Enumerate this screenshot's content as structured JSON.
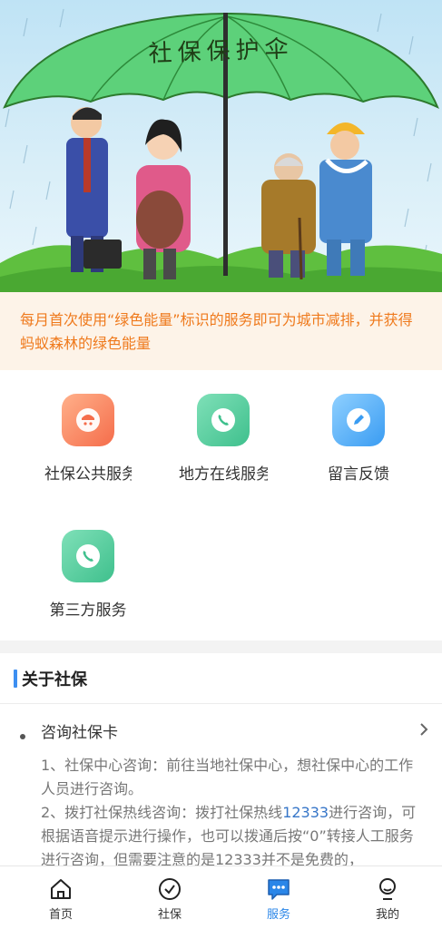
{
  "banner": {
    "umbrella_title": "社保保护伞"
  },
  "notice": {
    "text": "每月首次使用“绿色能量”标识的服务即可为城市减排，并获得蚂蚁森林的绿色能量"
  },
  "services": [
    {
      "label": "社保公共服务",
      "icon": "social-security-icon",
      "color": "#f56d4b"
    },
    {
      "label": "地方在线服务",
      "icon": "phone-icon",
      "color": "#3fc08d"
    },
    {
      "label": "留言反馈",
      "icon": "pen-icon",
      "color": "#3a9cf2"
    },
    {
      "label": "第三方服务",
      "icon": "phone-icon",
      "color": "#3fc08d"
    }
  ],
  "about": {
    "title": "关于社保",
    "faq": {
      "question": "咨询社保卡",
      "line1": "1、社保中心咨询：前往当地社保中心，想社保中心的工作人员进行咨询。",
      "line2_pre": "2、拨打社保热线咨询：拨打社保热线",
      "hotline": "12333",
      "line2_post": "进行咨询，可根据语音提示进行操作，也可以拨通后按“0”转接人工服务进行咨询，但需要注意的是12333并不是免费的，"
    }
  },
  "tabbar": {
    "tabs": [
      {
        "label": "首页",
        "icon": "home-icon"
      },
      {
        "label": "社保",
        "icon": "check-circle-icon"
      },
      {
        "label": "服务",
        "icon": "chat-icon",
        "active": true
      },
      {
        "label": "我的",
        "icon": "user-icon"
      }
    ],
    "active_color": "#2a86e8"
  }
}
